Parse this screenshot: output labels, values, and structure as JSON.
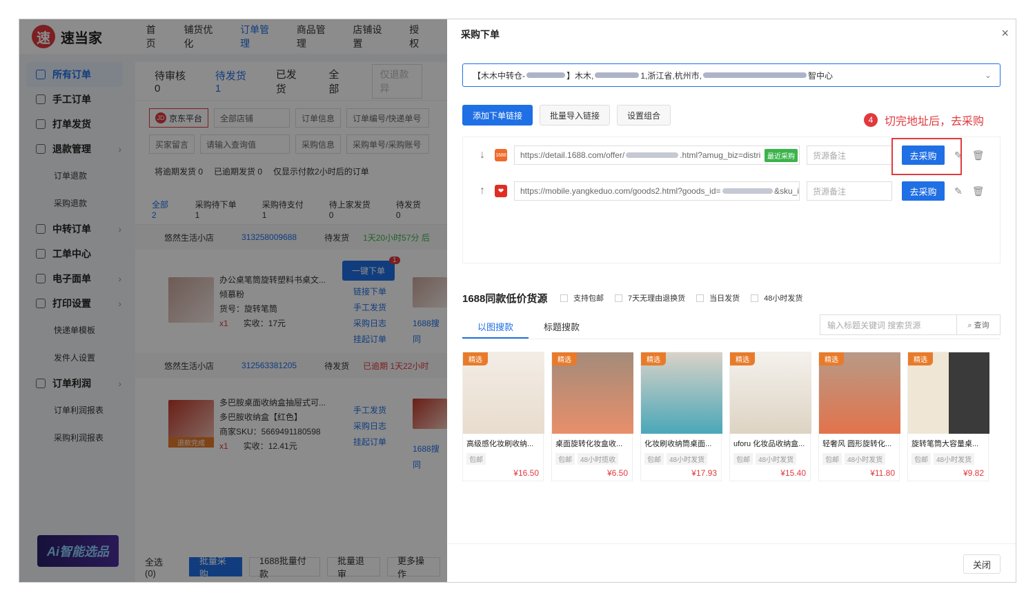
{
  "app": {
    "logo_char": "速",
    "logo_text": "速当家",
    "nav": [
      "首页",
      "铺货优化",
      "订单管理",
      "商品管理",
      "店铺设置",
      "授权"
    ],
    "sidebar": [
      {
        "label": "所有订单",
        "type": "item"
      },
      {
        "label": "手工订单",
        "type": "item"
      },
      {
        "label": "打单发货",
        "type": "item"
      },
      {
        "label": "退款管理",
        "type": "item"
      },
      {
        "label": "订单退款",
        "type": "sub"
      },
      {
        "label": "采购退款",
        "type": "sub"
      },
      {
        "label": "中转订单",
        "type": "item"
      },
      {
        "label": "工单中心",
        "type": "item"
      },
      {
        "label": "电子面单",
        "type": "item"
      },
      {
        "label": "打印设置",
        "type": "item"
      },
      {
        "label": "快递单模板",
        "type": "sub"
      },
      {
        "label": "发件人设置",
        "type": "sub"
      },
      {
        "label": "订单利润",
        "type": "item"
      },
      {
        "label": "订单利润报表",
        "type": "sub"
      },
      {
        "label": "采购利润报表",
        "type": "sub"
      }
    ],
    "ai_banner": "Ai智能选品",
    "tabs": [
      "待审核 0",
      "待发货 1",
      "已发货",
      "全部"
    ],
    "tab_search": "仅退款异",
    "filters1": [
      "京东平台",
      "全部店铺",
      "订单信息",
      "订单编号/快递单号"
    ],
    "filters2": [
      "买家留言",
      "请输入查询值",
      "采购信息",
      "采购单号/采购账号"
    ],
    "notes": [
      "将逾期发货 0",
      "已逾期发货 0",
      "仅显示付款2小时后的订单"
    ],
    "subtabs": [
      "全部 2",
      "采购待下单 1",
      "采购待支付 1",
      "待上家发货 0",
      "待发货 0"
    ],
    "orders": [
      {
        "shop": "悠然生活小店",
        "order_no": "313258009688",
        "status": "待发货",
        "time": "1天20小时57分 后",
        "title": "办公桌笔筒旋转塑料书桌文...",
        "spec": "倾慕粉",
        "sku": "货号：旋转笔筒",
        "qty": "x1",
        "paid": "实收：17元",
        "action": "一键下单",
        "badge": "1",
        "links": [
          "链接下单",
          "手工发货",
          "采购日志",
          "挂起订单"
        ],
        "search": "1688搜同"
      },
      {
        "shop": "悠然生活小店",
        "order_no": "312563381205",
        "status": "待发货",
        "time": "已逾期 1天22小时",
        "title": "多巴胺桌面收纳盒抽屉式可...",
        "spec": "多巴胺收纳盒【红色】",
        "sku": "商家SKU：5669491180598",
        "qty": "x1",
        "paid": "实收：12.41元",
        "refund_tag": "退款完成",
        "links": [
          "手工发货",
          "采购日志",
          "挂起订单"
        ],
        "search": "1688搜同"
      }
    ],
    "bottom": [
      "全选(0)",
      "批量采购",
      "1688批量付款",
      "批量退审",
      "更多操作"
    ]
  },
  "drawer": {
    "title": "采购下单",
    "close_x": "×",
    "address_a": "【木木中转仓-",
    "address_b": "】木木,",
    "address_c": "1,浙江省,杭州市,",
    "address_d": "智中心",
    "buttons": [
      "添加下单链接",
      "批量导入链接",
      "设置组合"
    ],
    "annotation_num": "4",
    "annotation_text": "切完地址后，去采购",
    "links": [
      {
        "arrow": "↓",
        "icon": "1688",
        "url": "https://detail.1688.com/offer/",
        "url_tail": ".html?amug_biz=distri",
        "tag": "最近采购",
        "note_placeholder": "货源备注",
        "buy": "去采购"
      },
      {
        "arrow": "↑",
        "icon": "pdd",
        "url": "https://mobile.yangkeduo.com/goods2.html?goods_id=",
        "url_tail": "&sku_i",
        "note_placeholder": "货源备注",
        "buy": "去采购"
      }
    ],
    "section_title": "1688同款低价货源",
    "checks": [
      "支持包邮",
      "7天无理由退换货",
      "当日发货",
      "48小时发货"
    ],
    "search_tabs": [
      "以图搜款",
      "标题搜款"
    ],
    "search_placeholder": "输入标题关键词  搜索货源",
    "search_btn": "查询",
    "cards": [
      {
        "tag": "精选",
        "name": "高级感化妆刷收纳...",
        "meta": [
          "包邮"
        ],
        "price": "¥16.50"
      },
      {
        "tag": "精选",
        "name": "桌面旋转化妆盒收...",
        "meta": [
          "包邮",
          "48小时揽收"
        ],
        "price": "¥6.50"
      },
      {
        "tag": "精选",
        "name": "化妆刷收纳筒桌面...",
        "meta": [
          "包邮",
          "48小时发货"
        ],
        "price": "¥17.93"
      },
      {
        "tag": "精选",
        "name": "uforu 化妆品收纳盒...",
        "meta": [
          "包邮",
          "48小时发货"
        ],
        "price": "¥15.40"
      },
      {
        "tag": "精选",
        "name": "轻奢风 圆形旋转化...",
        "meta": [
          "包邮",
          "48小时发货"
        ],
        "price": "¥11.80"
      },
      {
        "tag": "精选",
        "name": "旋转笔筒大容量桌...",
        "meta": [
          "包邮",
          "48小时发货"
        ],
        "price": "¥9.82"
      }
    ],
    "close_btn": "关闭",
    "colors": {
      "primary": "#1f6fe5",
      "danger": "#e0393e",
      "tag_orange": "#e87b2a",
      "tag_green": "#3bb34a"
    }
  }
}
